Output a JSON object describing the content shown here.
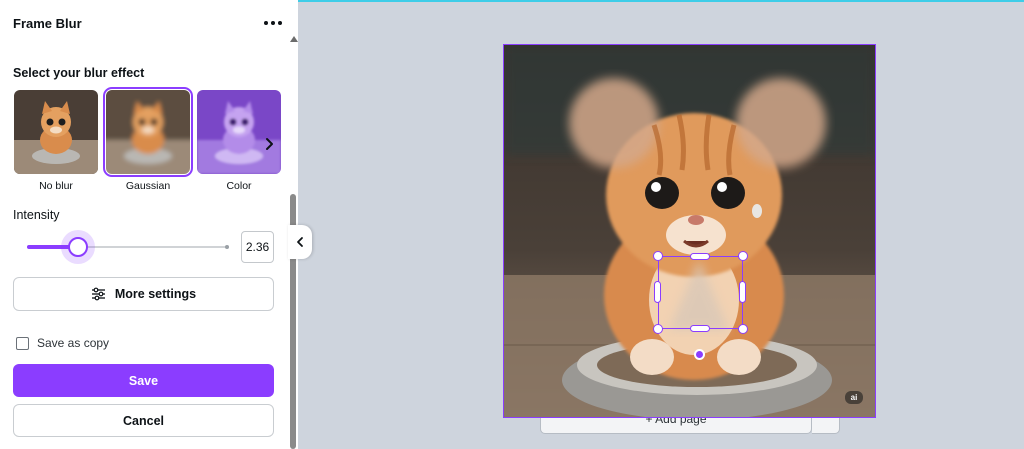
{
  "panel": {
    "title": "Frame Blur",
    "section_heading": "Select your blur effect",
    "effects": [
      {
        "label": "No blur",
        "selected": false
      },
      {
        "label": "Gaussian",
        "selected": true
      },
      {
        "label": "Color",
        "selected": false
      }
    ],
    "intensity_label": "Intensity",
    "intensity_value": "2.36",
    "intensity_fraction": 0.25,
    "more_settings_label": "More settings",
    "save_as_copy_label": "Save as copy",
    "save_as_copy_checked": false,
    "save_label": "Save",
    "cancel_label": "Cancel"
  },
  "canvas": {
    "add_page_label": "+ Add page",
    "ai_badge": "ai"
  },
  "colors": {
    "accent": "#8b3dff",
    "workspace": "#ced4dd",
    "top_accent": "#3ecde8"
  },
  "icons": [
    "more-horizontal-icon",
    "chevron-right-icon",
    "chevron-left-icon",
    "sliders-icon"
  ]
}
